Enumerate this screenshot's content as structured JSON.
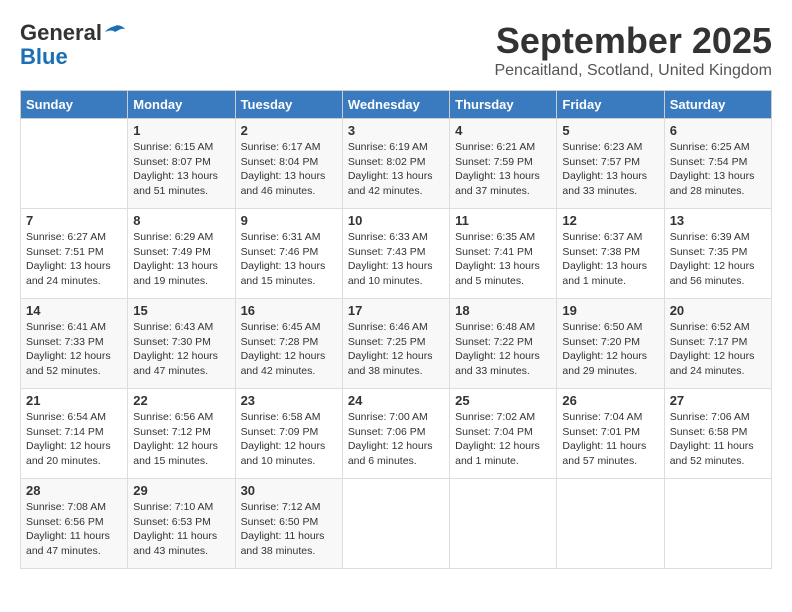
{
  "header": {
    "logo_line1": "General",
    "logo_line2": "Blue",
    "month": "September 2025",
    "location": "Pencaitland, Scotland, United Kingdom"
  },
  "weekdays": [
    "Sunday",
    "Monday",
    "Tuesday",
    "Wednesday",
    "Thursday",
    "Friday",
    "Saturday"
  ],
  "weeks": [
    [
      {
        "day": "",
        "info": ""
      },
      {
        "day": "1",
        "info": "Sunrise: 6:15 AM\nSunset: 8:07 PM\nDaylight: 13 hours\nand 51 minutes."
      },
      {
        "day": "2",
        "info": "Sunrise: 6:17 AM\nSunset: 8:04 PM\nDaylight: 13 hours\nand 46 minutes."
      },
      {
        "day": "3",
        "info": "Sunrise: 6:19 AM\nSunset: 8:02 PM\nDaylight: 13 hours\nand 42 minutes."
      },
      {
        "day": "4",
        "info": "Sunrise: 6:21 AM\nSunset: 7:59 PM\nDaylight: 13 hours\nand 37 minutes."
      },
      {
        "day": "5",
        "info": "Sunrise: 6:23 AM\nSunset: 7:57 PM\nDaylight: 13 hours\nand 33 minutes."
      },
      {
        "day": "6",
        "info": "Sunrise: 6:25 AM\nSunset: 7:54 PM\nDaylight: 13 hours\nand 28 minutes."
      }
    ],
    [
      {
        "day": "7",
        "info": "Sunrise: 6:27 AM\nSunset: 7:51 PM\nDaylight: 13 hours\nand 24 minutes."
      },
      {
        "day": "8",
        "info": "Sunrise: 6:29 AM\nSunset: 7:49 PM\nDaylight: 13 hours\nand 19 minutes."
      },
      {
        "day": "9",
        "info": "Sunrise: 6:31 AM\nSunset: 7:46 PM\nDaylight: 13 hours\nand 15 minutes."
      },
      {
        "day": "10",
        "info": "Sunrise: 6:33 AM\nSunset: 7:43 PM\nDaylight: 13 hours\nand 10 minutes."
      },
      {
        "day": "11",
        "info": "Sunrise: 6:35 AM\nSunset: 7:41 PM\nDaylight: 13 hours\nand 5 minutes."
      },
      {
        "day": "12",
        "info": "Sunrise: 6:37 AM\nSunset: 7:38 PM\nDaylight: 13 hours\nand 1 minute."
      },
      {
        "day": "13",
        "info": "Sunrise: 6:39 AM\nSunset: 7:35 PM\nDaylight: 12 hours\nand 56 minutes."
      }
    ],
    [
      {
        "day": "14",
        "info": "Sunrise: 6:41 AM\nSunset: 7:33 PM\nDaylight: 12 hours\nand 52 minutes."
      },
      {
        "day": "15",
        "info": "Sunrise: 6:43 AM\nSunset: 7:30 PM\nDaylight: 12 hours\nand 47 minutes."
      },
      {
        "day": "16",
        "info": "Sunrise: 6:45 AM\nSunset: 7:28 PM\nDaylight: 12 hours\nand 42 minutes."
      },
      {
        "day": "17",
        "info": "Sunrise: 6:46 AM\nSunset: 7:25 PM\nDaylight: 12 hours\nand 38 minutes."
      },
      {
        "day": "18",
        "info": "Sunrise: 6:48 AM\nSunset: 7:22 PM\nDaylight: 12 hours\nand 33 minutes."
      },
      {
        "day": "19",
        "info": "Sunrise: 6:50 AM\nSunset: 7:20 PM\nDaylight: 12 hours\nand 29 minutes."
      },
      {
        "day": "20",
        "info": "Sunrise: 6:52 AM\nSunset: 7:17 PM\nDaylight: 12 hours\nand 24 minutes."
      }
    ],
    [
      {
        "day": "21",
        "info": "Sunrise: 6:54 AM\nSunset: 7:14 PM\nDaylight: 12 hours\nand 20 minutes."
      },
      {
        "day": "22",
        "info": "Sunrise: 6:56 AM\nSunset: 7:12 PM\nDaylight: 12 hours\nand 15 minutes."
      },
      {
        "day": "23",
        "info": "Sunrise: 6:58 AM\nSunset: 7:09 PM\nDaylight: 12 hours\nand 10 minutes."
      },
      {
        "day": "24",
        "info": "Sunrise: 7:00 AM\nSunset: 7:06 PM\nDaylight: 12 hours\nand 6 minutes."
      },
      {
        "day": "25",
        "info": "Sunrise: 7:02 AM\nSunset: 7:04 PM\nDaylight: 12 hours\nand 1 minute."
      },
      {
        "day": "26",
        "info": "Sunrise: 7:04 AM\nSunset: 7:01 PM\nDaylight: 11 hours\nand 57 minutes."
      },
      {
        "day": "27",
        "info": "Sunrise: 7:06 AM\nSunset: 6:58 PM\nDaylight: 11 hours\nand 52 minutes."
      }
    ],
    [
      {
        "day": "28",
        "info": "Sunrise: 7:08 AM\nSunset: 6:56 PM\nDaylight: 11 hours\nand 47 minutes."
      },
      {
        "day": "29",
        "info": "Sunrise: 7:10 AM\nSunset: 6:53 PM\nDaylight: 11 hours\nand 43 minutes."
      },
      {
        "day": "30",
        "info": "Sunrise: 7:12 AM\nSunset: 6:50 PM\nDaylight: 11 hours\nand 38 minutes."
      },
      {
        "day": "",
        "info": ""
      },
      {
        "day": "",
        "info": ""
      },
      {
        "day": "",
        "info": ""
      },
      {
        "day": "",
        "info": ""
      }
    ]
  ]
}
